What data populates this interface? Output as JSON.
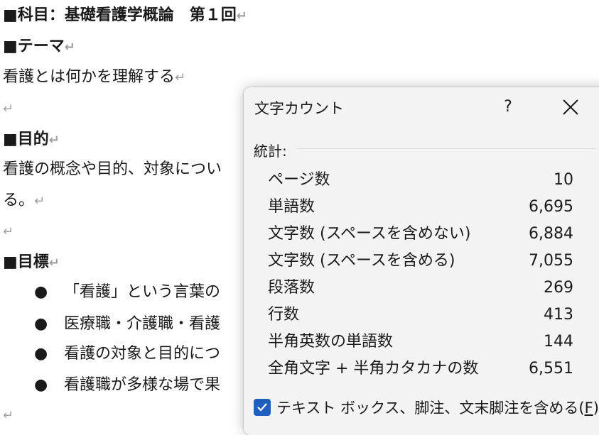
{
  "document": {
    "subject_heading": "■科目：基礎看護学概論　第１回",
    "theme_heading": "■テーマ",
    "theme_text": "看護とは何かを理解する",
    "purpose_heading": "■目的",
    "purpose_text_1": "看護の概念や目的、対象につい",
    "purpose_text_2": "る。",
    "goals_heading": "■目標",
    "bullets": [
      "「看護」という言葉の",
      "医療職・介護職・看護",
      "看護の対象と目的につ",
      "看護職が多様な場で果"
    ],
    "paragraph_mark": "↵",
    "bullet_glyph": "●"
  },
  "dialog": {
    "title": "文字カウント",
    "help_label": "?",
    "section_label": "統計:",
    "stats": [
      {
        "label": "ページ数",
        "value": "10"
      },
      {
        "label": "単語数",
        "value": "6,695"
      },
      {
        "label": "文字数 (スペースを含めない)",
        "value": "6,884"
      },
      {
        "label": "文字数 (スペースを含める)",
        "value": "7,055"
      },
      {
        "label": "段落数",
        "value": "269"
      },
      {
        "label": "行数",
        "value": "413"
      },
      {
        "label": "半角英数の単語数",
        "value": "144"
      },
      {
        "label": "全角文字 + 半角カタカナの数",
        "value": "6,551"
      }
    ],
    "checkbox_label": "テキスト ボックス、脚注、文末脚注を含める(",
    "checkbox_accel": "F",
    "checkbox_close": ")",
    "checkbox_checked": true,
    "accent_color": "#1f5fbf"
  }
}
